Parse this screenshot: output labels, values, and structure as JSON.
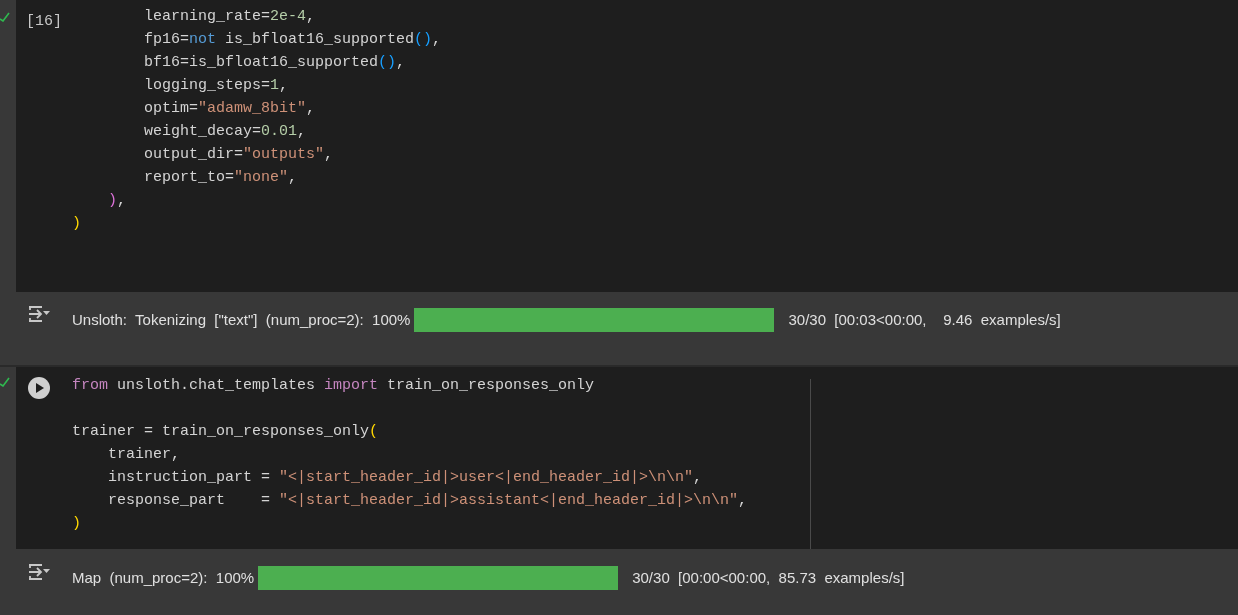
{
  "cells": [
    {
      "kind": "executed",
      "execution_count": "[16]",
      "lines": [
        {
          "kind": "deep",
          "tokens": [
            {
              "t": "learning_rate=",
              "kind": "plain"
            },
            {
              "t": "2e-4",
              "kind": "number"
            },
            {
              "t": ",",
              "kind": "plain"
            }
          ]
        },
        {
          "kind": "deep",
          "tokens": [
            {
              "t": "fp16=",
              "kind": "plain"
            },
            {
              "t": "not",
              "kind": "keyword"
            },
            {
              "t": " is_bfloat16_supported",
              "kind": "plain"
            },
            {
              "t": "()",
              "kind": "paren"
            },
            {
              "t": ",",
              "kind": "plain"
            }
          ]
        },
        {
          "kind": "deep",
          "tokens": [
            {
              "t": "bf16=is_bfloat16_supported",
              "kind": "plain"
            },
            {
              "t": "()",
              "kind": "paren"
            },
            {
              "t": ",",
              "kind": "plain"
            }
          ]
        },
        {
          "kind": "deep",
          "tokens": [
            {
              "t": "logging_steps=",
              "kind": "plain"
            },
            {
              "t": "1",
              "kind": "number"
            },
            {
              "t": ",",
              "kind": "plain"
            }
          ]
        },
        {
          "kind": "deep",
          "tokens": [
            {
              "t": "optim=",
              "kind": "plain"
            },
            {
              "t": "\"adamw_8bit\"",
              "kind": "string"
            },
            {
              "t": ",",
              "kind": "plain"
            }
          ]
        },
        {
          "kind": "deep",
          "tokens": [
            {
              "t": "weight_decay=",
              "kind": "plain"
            },
            {
              "t": "0.01",
              "kind": "number"
            },
            {
              "t": ",",
              "kind": "plain"
            }
          ]
        },
        {
          "kind": "deep",
          "tokens": [
            {
              "t": "output_dir=",
              "kind": "plain"
            },
            {
              "t": "\"outputs\"",
              "kind": "string"
            },
            {
              "t": ",",
              "kind": "plain"
            }
          ]
        },
        {
          "kind": "deep",
          "tokens": [
            {
              "t": "report_to=",
              "kind": "plain"
            },
            {
              "t": "\"none\"",
              "kind": "string"
            },
            {
              "t": ",",
              "kind": "plain"
            }
          ]
        },
        {
          "kind": "inner",
          "tokens": [
            {
              "t": ")",
              "kind": "bracket2"
            },
            {
              "t": ",",
              "kind": "plain"
            }
          ]
        },
        {
          "kind": "top",
          "tokens": [
            {
              "t": ")",
              "kind": "bracket1"
            }
          ]
        }
      ],
      "output": {
        "label": "Unsloth:  Tokenizing  [\"text\"]  (num_proc=2):  100%",
        "level": 1,
        "stats": "30/30  [00:03<00:00,    9.46  examples/s]"
      }
    },
    {
      "kind": "runnable",
      "lines": [
        {
          "kind": "top",
          "tokens": [
            {
              "t": "from",
              "kind": "import"
            },
            {
              "t": " unsloth.chat_templates ",
              "kind": "plain"
            },
            {
              "t": "import",
              "kind": "import"
            },
            {
              "t": " train_on_responses_only",
              "kind": "plain"
            }
          ]
        },
        {
          "kind": "blank"
        },
        {
          "kind": "top",
          "tokens": [
            {
              "t": "trainer = train_on_responses_only",
              "kind": "plain"
            },
            {
              "t": "(",
              "kind": "bracket1"
            }
          ]
        },
        {
          "kind": "inner",
          "tokens": [
            {
              "t": "trainer,",
              "kind": "plain"
            }
          ]
        },
        {
          "kind": "inner",
          "tokens": [
            {
              "t": "instruction_part = ",
              "kind": "plain"
            },
            {
              "t": "\"<|start_header_id|>user<|end_header_id|>\\n\\n\"",
              "kind": "string"
            },
            {
              "t": ",",
              "kind": "plain"
            }
          ]
        },
        {
          "kind": "inner",
          "tokens": [
            {
              "t": "response_part    = ",
              "kind": "plain"
            },
            {
              "t": "\"<|start_header_id|>assistant<|end_header_id|>\\n\\n\"",
              "kind": "string"
            },
            {
              "t": ",",
              "kind": "plain"
            }
          ]
        },
        {
          "kind": "top",
          "tokens": [
            {
              "t": ")",
              "kind": "bracket1"
            }
          ]
        }
      ],
      "output": {
        "label": "Map  (num_proc=2):  100%",
        "level": 1,
        "stats": "30/30  [00:00<00:00,  85.73  examples/s]"
      }
    }
  ]
}
